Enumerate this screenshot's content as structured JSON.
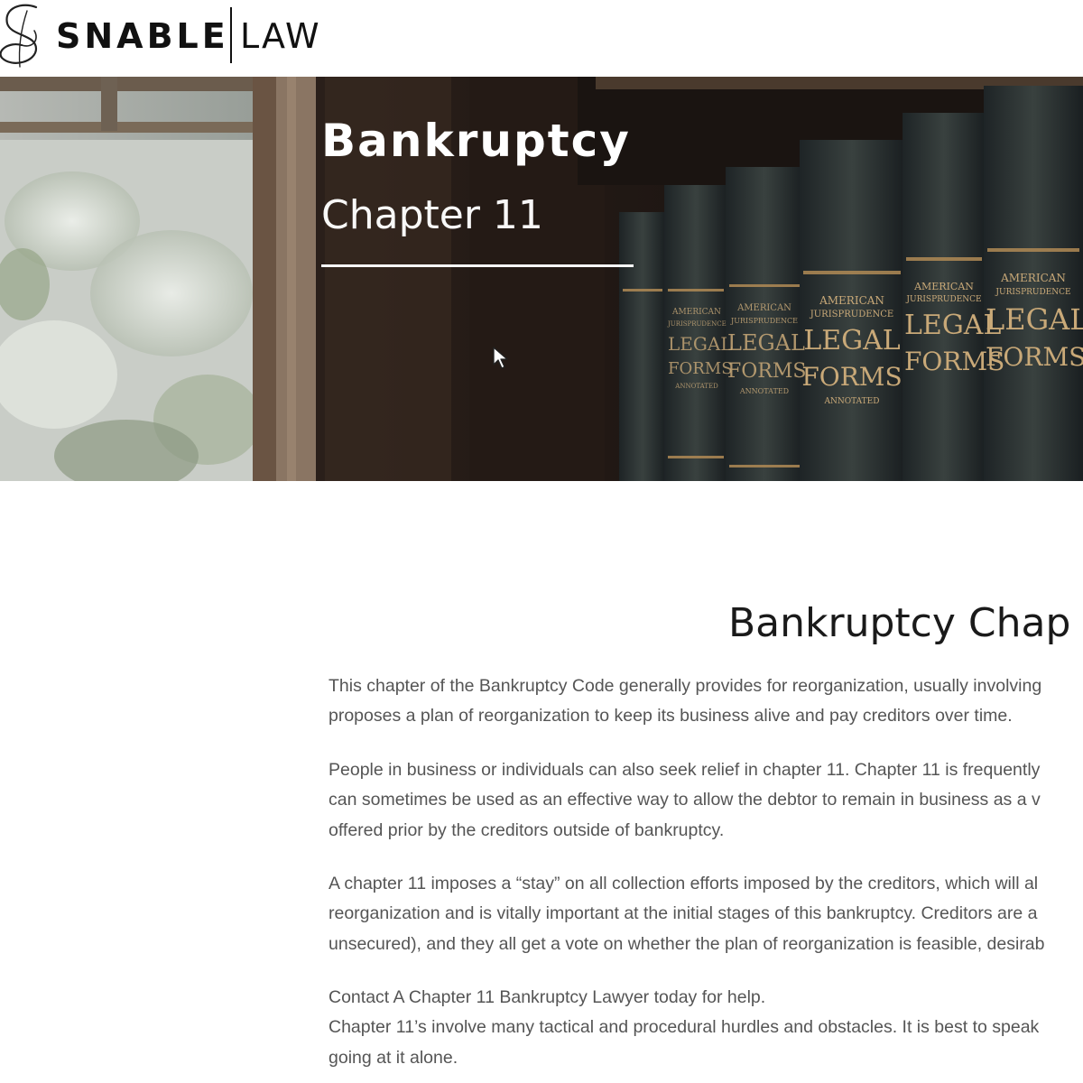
{
  "header": {
    "logo_word": "SNABLE",
    "logo_suffix": "LAW"
  },
  "hero": {
    "title": "Bankruptcy",
    "subtitle": "Chapter 11",
    "book_spines": [
      {
        "line1": "AMERICAN",
        "line2": "JURISPRUDENCE",
        "line3": "LEGAL",
        "line4": "FORMS",
        "line5": "ANNOTATED"
      },
      {
        "line1": "AMERICAN",
        "line2": "JURISPRUDENCE",
        "line3": "LEGAL",
        "line4": "FORMS",
        "line5": "ANNOTATED"
      },
      {
        "line1": "AMERICAN",
        "line2": "JURISPRUDENCE",
        "line3": "LEGAL",
        "line4": "FORMS",
        "line5": "ANNOTATED"
      },
      {
        "line1": "AMERICAN",
        "line2": "JURISPRUDENCE",
        "line3": "LEGAL",
        "line4": "FORMS",
        "line5": ""
      },
      {
        "line1": "AMERICAN",
        "line2": "JURISPRUDENCE",
        "line3": "LEGAL",
        "line4": "FORMS",
        "line5": ""
      }
    ]
  },
  "content": {
    "heading": "Bankruptcy Chap",
    "paragraphs": [
      {
        "lines": [
          "This chapter of the Bankruptcy Code generally provides for reorganization, usually involving",
          "proposes a plan of reorganization to keep its business alive and pay creditors over time."
        ]
      },
      {
        "lines": [
          "People in business or individuals can also seek relief in chapter 11. Chapter 11 is frequently",
          "can sometimes be used as an effective way to allow the debtor to remain in business as a v",
          "offered prior by the creditors outside of bankruptcy."
        ]
      },
      {
        "lines": [
          "A chapter 11 imposes a “stay” on all collection efforts imposed by the creditors, which will al",
          "reorganization and is vitally important at the initial stages of this bankruptcy. Creditors are a",
          "unsecured), and they all get a vote on whether the plan of reorganization is feasible, desirab"
        ]
      },
      {
        "lines": [
          "Contact A Chapter 11 Bankruptcy Lawyer today for help.",
          "Chapter 11’s involve many tactical and procedural hurdles and obstacles. It is best to speak",
          "going at it alone."
        ]
      }
    ]
  }
}
